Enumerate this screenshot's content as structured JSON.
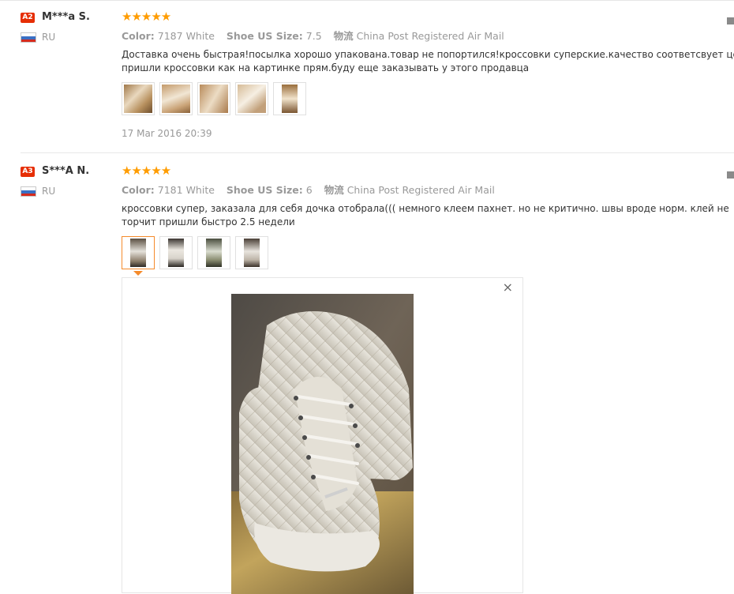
{
  "reviews": [
    {
      "level_badge": "A2",
      "name": "M***a S.",
      "country": "RU",
      "stars": "★★★★★",
      "color_label": "Color:",
      "color_value": "7187 White",
      "size_label": "Shoe US Size:",
      "size_value": "7.5",
      "shipping_label": "物流",
      "shipping_value": "China Post Registered Air Mail",
      "text_line1": "Доставка очень быстрая!посылка хорошо упакована.товар не попортился!кроссовки суперские.качество соответсвует цене",
      "text_line2": "пришли кроссовки как на картинке прям.буду еще заказывать у этого продавца",
      "photo_count": 5,
      "date": "17 Mar 2016 20:39"
    },
    {
      "level_badge": "A3",
      "name": "S***A N.",
      "country": "RU",
      "stars": "★★★★★",
      "color_label": "Color:",
      "color_value": "7181 White",
      "size_label": "Shoe US Size:",
      "size_value": "6",
      "shipping_label": "物流",
      "shipping_value": "China Post Registered Air Mail",
      "text_line1": "кроссовки супер, заказала для себя дочка отобрала((( немного клеем пахнет. но не критично. швы вроде норм. клей не",
      "text_line2": "торчит пришли быстро 2.5 недели",
      "photo_count": 4,
      "selected_photo": 1
    }
  ],
  "preview": {
    "close_icon": "×"
  },
  "colors": {
    "star": "#ff9c00",
    "badge": "#e62e04",
    "active_thumb": "#f58b2c"
  }
}
